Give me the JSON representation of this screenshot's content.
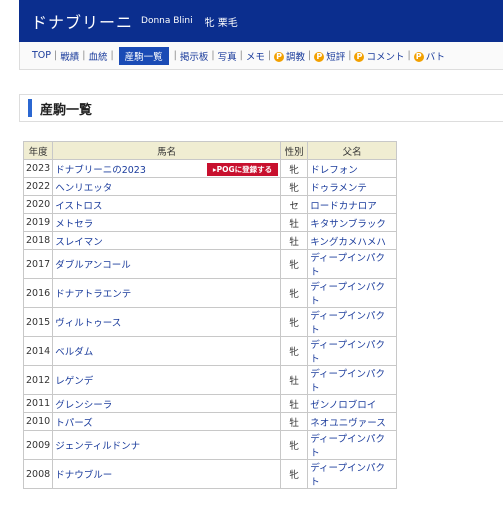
{
  "horse": {
    "name_jp": "ドナブリーニ",
    "name_en": "Donna Blini",
    "sex_coat": "牝 栗毛"
  },
  "nav": {
    "items": [
      {
        "label": "TOP"
      },
      {
        "label": "戦績"
      },
      {
        "label": "血統"
      },
      {
        "label": "産駒一覧",
        "active": true
      },
      {
        "label": "掲示板"
      },
      {
        "label": "写真"
      },
      {
        "label": "メモ"
      },
      {
        "label": "調教",
        "badge": true
      },
      {
        "label": "短評",
        "badge": true
      },
      {
        "label": "コメント",
        "badge": true
      },
      {
        "label": "バト",
        "badge": true
      }
    ],
    "badge_letter": "P",
    "separator": "|"
  },
  "section": {
    "title": "産駒一覧"
  },
  "table": {
    "headers": {
      "year": "年度",
      "name": "馬名",
      "sex": "性別",
      "sire": "父名"
    },
    "pog_button_label": "▸POGに登録する",
    "rows": [
      {
        "year": "2023",
        "name": "ドナブリーニの2023",
        "sex": "牝",
        "sire": "ドレフォン",
        "pog": true
      },
      {
        "year": "2022",
        "name": "ヘンリエッタ",
        "sex": "牝",
        "sire": "ドゥラメンテ"
      },
      {
        "year": "2020",
        "name": "イストロス",
        "sex": "セ",
        "sire": "ロードカナロア"
      },
      {
        "year": "2019",
        "name": "メトセラ",
        "sex": "牡",
        "sire": "キタサンブラック"
      },
      {
        "year": "2018",
        "name": "スレイマン",
        "sex": "牡",
        "sire": "キングカメハメハ"
      },
      {
        "year": "2017",
        "name": "ダブルアンコール",
        "sex": "牝",
        "sire": "ディープインパクト"
      },
      {
        "year": "2016",
        "name": "ドナアトラエンテ",
        "sex": "牝",
        "sire": "ディープインパクト"
      },
      {
        "year": "2015",
        "name": "ヴィルトゥース",
        "sex": "牝",
        "sire": "ディープインパクト"
      },
      {
        "year": "2014",
        "name": "ベルダム",
        "sex": "牝",
        "sire": "ディープインパクト"
      },
      {
        "year": "2012",
        "name": "レゲンデ",
        "sex": "牡",
        "sire": "ディープインパクト"
      },
      {
        "year": "2011",
        "name": "グレンシーラ",
        "sex": "牡",
        "sire": "ゼンノロブロイ"
      },
      {
        "year": "2010",
        "name": "トパーズ",
        "sex": "牡",
        "sire": "ネオユニヴァース"
      },
      {
        "year": "2009",
        "name": "ジェンティルドンナ",
        "sex": "牝",
        "sire": "ディープインパクト"
      },
      {
        "year": "2008",
        "name": "ドナウブルー",
        "sex": "牝",
        "sire": "ディープインパクト"
      }
    ]
  }
}
